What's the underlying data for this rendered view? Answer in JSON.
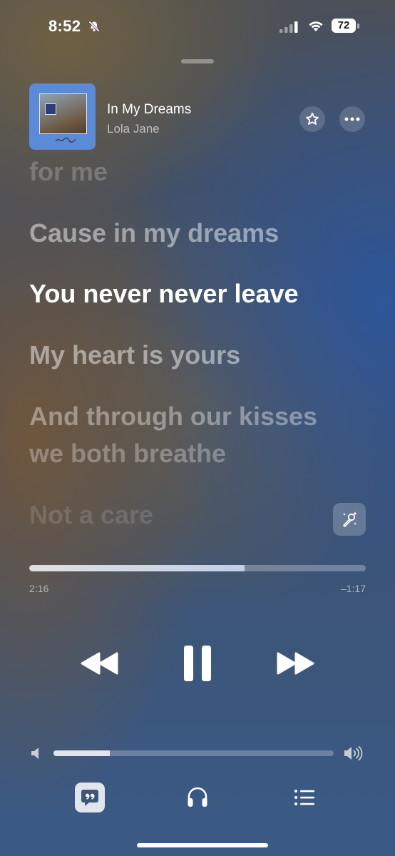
{
  "status_bar": {
    "time": "8:52",
    "battery": "72"
  },
  "now_playing": {
    "title": "In My Dreams",
    "artist": "Lola Jane"
  },
  "lyrics": [
    "for me",
    "Cause in my dreams",
    "You never never leave",
    "My heart is yours",
    "And through our kisses",
    "we both breathe",
    "Not a care"
  ],
  "progress": {
    "elapsed": "2:16",
    "remaining": "–1:17",
    "fraction": 0.64
  },
  "volume": {
    "fraction": 0.2
  },
  "icons": {
    "mute": "bell-slash-icon",
    "favorite": "star-icon",
    "more": "ellipsis-icon",
    "sing": "microphone-sparkle-icon",
    "rewind": "backward-icon",
    "pause": "pause-icon",
    "forward": "forward-icon",
    "lyrics": "quote-bubble-icon",
    "output": "headphones-icon",
    "queue": "list-icon"
  }
}
